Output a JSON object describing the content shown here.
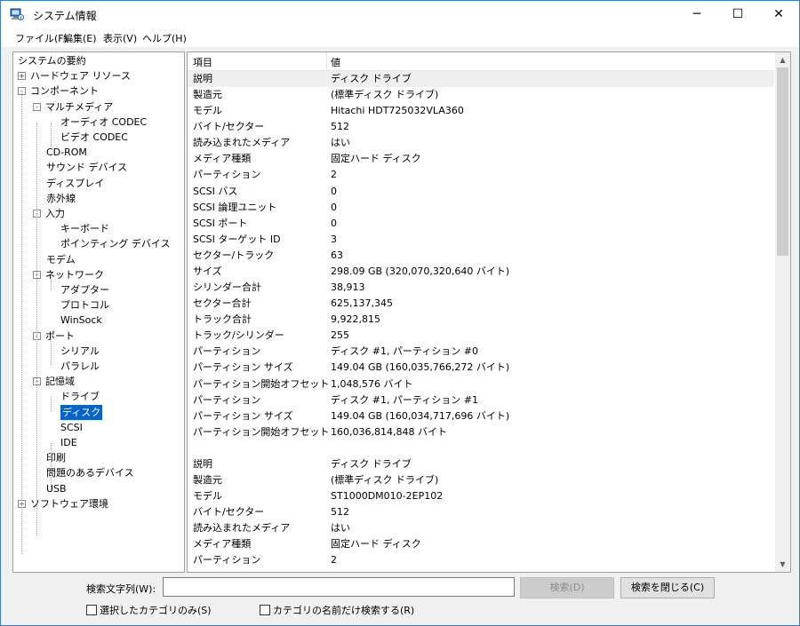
{
  "window": {
    "title": "システム情報"
  },
  "title_controls": {
    "minimize": "─",
    "maximize": "☐",
    "close": "✕"
  },
  "menu": [
    "ファイル(F)",
    "編集(E)",
    "表示(V)",
    "ヘルプ(H)"
  ],
  "tree": [
    {
      "label": "システムの要約",
      "level": 0,
      "expander": ""
    },
    {
      "label": "ハードウェア リソース",
      "level": 0,
      "expander": "+"
    },
    {
      "label": "コンポーネント",
      "level": 0,
      "expander": "-"
    },
    {
      "label": "マルチメディア",
      "level": 1,
      "expander": "-"
    },
    {
      "label": "オーディオ CODEC",
      "level": 2,
      "expander": ""
    },
    {
      "label": "ビデオ CODEC",
      "level": 2,
      "expander": ""
    },
    {
      "label": "CD-ROM",
      "level": 1,
      "expander": ""
    },
    {
      "label": "サウンド デバイス",
      "level": 1,
      "expander": ""
    },
    {
      "label": "ディスプレイ",
      "level": 1,
      "expander": ""
    },
    {
      "label": "赤外線",
      "level": 1,
      "expander": ""
    },
    {
      "label": "入力",
      "level": 1,
      "expander": "-"
    },
    {
      "label": "キーボード",
      "level": 2,
      "expander": ""
    },
    {
      "label": "ポインティング デバイス",
      "level": 2,
      "expander": ""
    },
    {
      "label": "モデム",
      "level": 1,
      "expander": ""
    },
    {
      "label": "ネットワーク",
      "level": 1,
      "expander": "-"
    },
    {
      "label": "アダプター",
      "level": 2,
      "expander": ""
    },
    {
      "label": "プロトコル",
      "level": 2,
      "expander": ""
    },
    {
      "label": "WinSock",
      "level": 2,
      "expander": ""
    },
    {
      "label": "ポート",
      "level": 1,
      "expander": "-"
    },
    {
      "label": "シリアル",
      "level": 2,
      "expander": ""
    },
    {
      "label": "パラレル",
      "level": 2,
      "expander": ""
    },
    {
      "label": "記憶域",
      "level": 1,
      "expander": "-"
    },
    {
      "label": "ドライブ",
      "level": 2,
      "expander": ""
    },
    {
      "label": "ディスク",
      "level": 2,
      "expander": "",
      "selected": true
    },
    {
      "label": "SCSI",
      "level": 2,
      "expander": ""
    },
    {
      "label": "IDE",
      "level": 2,
      "expander": ""
    },
    {
      "label": "印刷",
      "level": 1,
      "expander": ""
    },
    {
      "label": "問題のあるデバイス",
      "level": 1,
      "expander": ""
    },
    {
      "label": "USB",
      "level": 1,
      "expander": ""
    },
    {
      "label": "ソフトウェア環境",
      "level": 0,
      "expander": "+"
    }
  ],
  "details": {
    "columns": [
      "項目",
      "値"
    ],
    "rows": [
      [
        "説明",
        "ディスク ドライブ"
      ],
      [
        "製造元",
        "(標準ディスク ドライブ)"
      ],
      [
        "モデル",
        "Hitachi HDT725032VLA360"
      ],
      [
        "バイト/セクター",
        "512"
      ],
      [
        "読み込まれたメディア",
        "はい"
      ],
      [
        "メディア種類",
        "固定ハード ディスク"
      ],
      [
        "パーティション",
        "2"
      ],
      [
        "SCSI バス",
        "0"
      ],
      [
        "SCSI 論理ユニット",
        "0"
      ],
      [
        "SCSI ポート",
        "0"
      ],
      [
        "SCSI ターゲット ID",
        "3"
      ],
      [
        "セクター/トラック",
        "63"
      ],
      [
        "サイズ",
        "298.09 GB (320,070,320,640 バイト)"
      ],
      [
        "シリンダー合計",
        "38,913"
      ],
      [
        "セクター合計",
        "625,137,345"
      ],
      [
        "トラック合計",
        "9,922,815"
      ],
      [
        "トラック/シリンダー",
        "255"
      ],
      [
        "パーティション",
        "ディスク #1, パーティション #0"
      ],
      [
        "パーティション サイズ",
        "149.04 GB (160,035,766,272 バイト)"
      ],
      [
        "パーティション開始オフセット",
        "1,048,576 バイト"
      ],
      [
        "パーティション",
        "ディスク #1, パーティション #1"
      ],
      [
        "パーティション サイズ",
        "149.04 GB (160,034,717,696 バイト)"
      ],
      [
        "パーティション開始オフセット",
        "160,036,814,848 バイト"
      ],
      [
        "",
        ""
      ],
      [
        "説明",
        "ディスク ドライブ"
      ],
      [
        "製造元",
        "(標準ディスク ドライブ)"
      ],
      [
        "モデル",
        "ST1000DM010-2EP102"
      ],
      [
        "バイト/セクター",
        "512"
      ],
      [
        "読み込まれたメディア",
        "はい"
      ],
      [
        "メディア種類",
        "固定ハード ディスク"
      ],
      [
        "パーティション",
        "2"
      ]
    ]
  },
  "search": {
    "label": "検索文字列(W):",
    "value": "",
    "find_button": "検索(D)",
    "close_button": "検索を閉じる(C)",
    "checkbox_selected_only": "選択したカテゴリのみ(S)",
    "checkbox_names_only": "カテゴリの名前だけ検索する(R)"
  }
}
